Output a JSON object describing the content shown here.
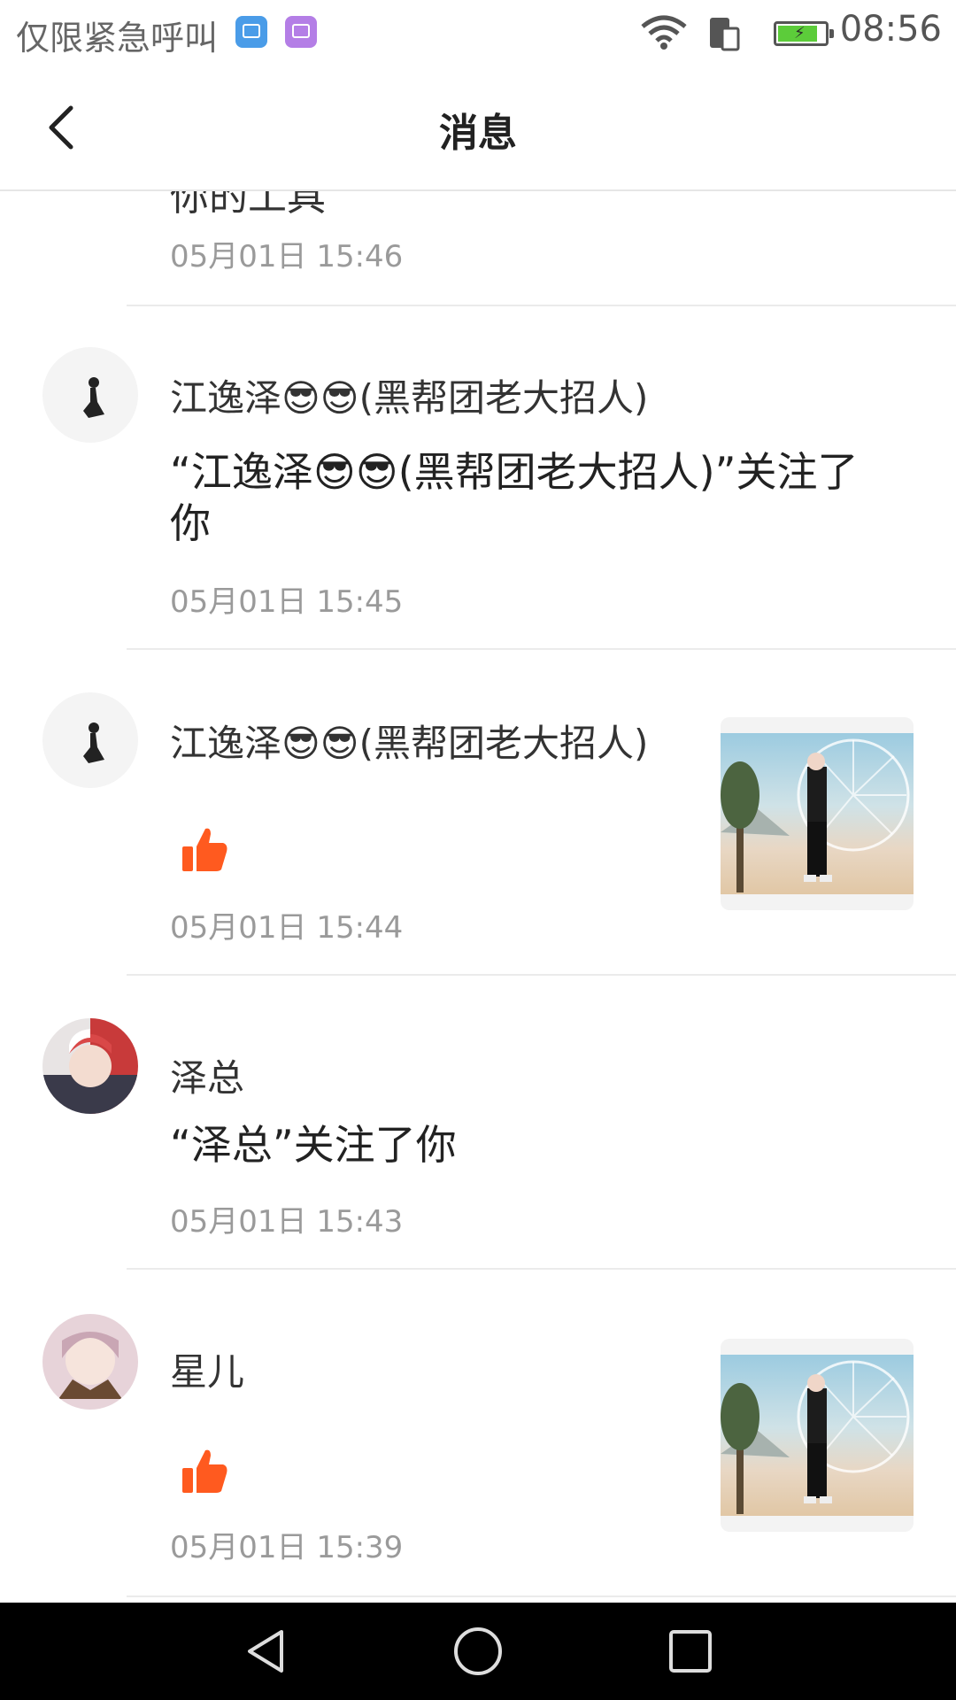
{
  "status_bar": {
    "carrier_text": "仅限紧急呼叫",
    "time": "08:56",
    "icons": [
      "gallery-app-icon",
      "keyboard-app-icon",
      "wifi-icon",
      "sim-icon",
      "battery-charging-icon"
    ]
  },
  "header": {
    "title": "消息",
    "back_icon": "chevron-left-icon"
  },
  "messages": [
    {
      "partial_text": "你的工具",
      "time": "05月01日 15:46"
    },
    {
      "name": "江逸泽😎😎(黑帮团老大招人)",
      "text": "“江逸泽😎😎(黑帮团老大招人)”关注了你",
      "time": "05月01日 15:45"
    },
    {
      "name": "江逸泽😎😎(黑帮团老大招人)",
      "like_icon": "thumbs-up-icon",
      "time": "05月01日 15:44"
    },
    {
      "name": "泽总",
      "text": "“泽总”关注了你",
      "time": "05月01日 15:43"
    },
    {
      "name": "星儿",
      "like_icon": "thumbs-up-icon",
      "time": "05月01日 15:39"
    }
  ],
  "colors": {
    "like": "#ff5a1f",
    "time": "#9a9a9a",
    "divider": "#ebebeb"
  },
  "nav_bar": {
    "icons": [
      "back-triangle-icon",
      "home-circle-icon",
      "recents-square-icon"
    ]
  }
}
